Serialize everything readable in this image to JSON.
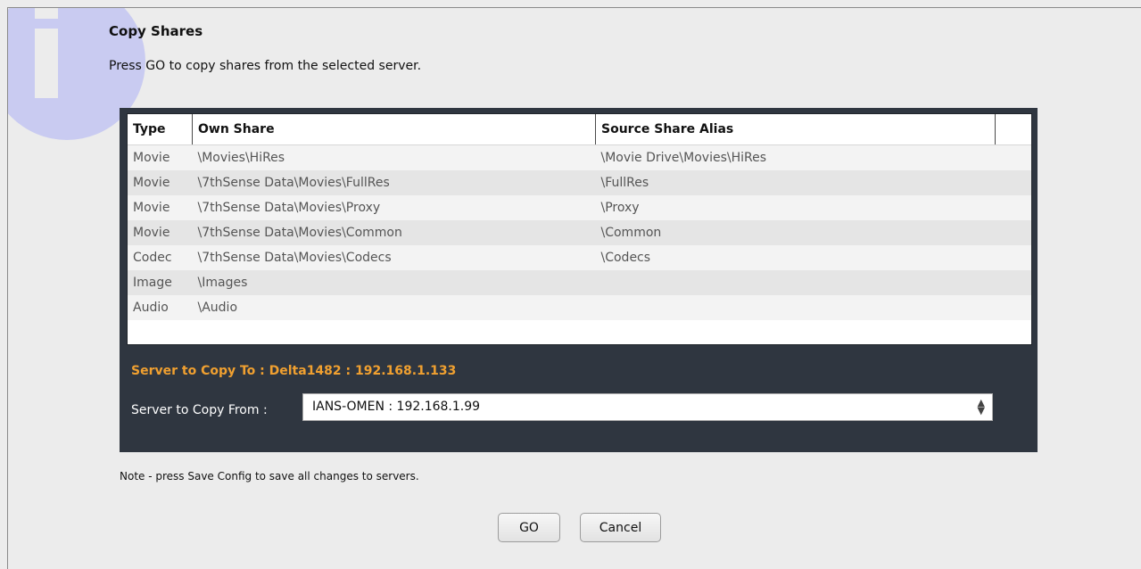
{
  "dialog": {
    "title": "Copy Shares",
    "subtitle": "Press GO to copy shares from the selected server."
  },
  "table": {
    "headers": [
      "Type",
      "Own Share",
      "Source Share Alias",
      ""
    ],
    "rows": [
      {
        "type": "Movie",
        "own_share": "\\Movies\\HiRes",
        "source_alias": "\\Movie Drive\\Movies\\HiRes"
      },
      {
        "type": "Movie",
        "own_share": "\\7thSense Data\\Movies\\FullRes",
        "source_alias": "\\FullRes"
      },
      {
        "type": "Movie",
        "own_share": "\\7thSense Data\\Movies\\Proxy",
        "source_alias": "\\Proxy"
      },
      {
        "type": "Movie",
        "own_share": "\\7thSense Data\\Movies\\Common",
        "source_alias": "\\Common"
      },
      {
        "type": "Codec",
        "own_share": "\\7thSense Data\\Movies\\Codecs",
        "source_alias": "\\Codecs"
      },
      {
        "type": "Image",
        "own_share": "\\Images",
        "source_alias": ""
      },
      {
        "type": "Audio",
        "own_share": "\\Audio",
        "source_alias": ""
      }
    ]
  },
  "server": {
    "copy_to": "Server to Copy To : Delta1482 : 192.168.1.133",
    "copy_from_label": "Server to Copy From :",
    "copy_from_value": "IANS-OMEN : 192.168.1.99"
  },
  "note": "Note - press Save Config to save all changes to servers.",
  "buttons": {
    "go": "GO",
    "cancel": "Cancel"
  },
  "colors": {
    "panel_bg": "#2f3640",
    "accent_orange": "#f0a030",
    "info_circle": "#c9cbf1"
  },
  "icons": {
    "info": "info-icon",
    "select_arrows": "up-down-chevron-icon"
  }
}
